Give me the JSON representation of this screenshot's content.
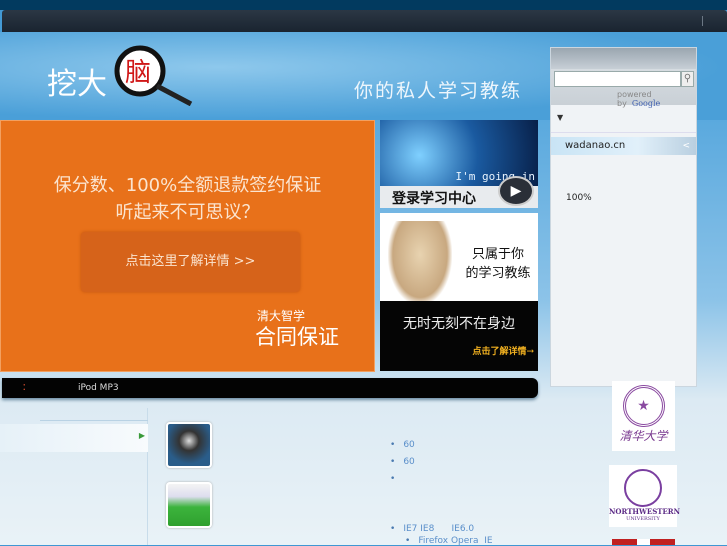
{
  "header": {
    "logo_text": "挖大脑",
    "slogan": "你的私人学习教练"
  },
  "search": {
    "placeholder": "",
    "powered_by": "powered by",
    "google": "Google"
  },
  "panel": {
    "dropdown_arrow": "▼",
    "site": "wadanao.cn",
    "zoom": "100%"
  },
  "promo": {
    "line1": "保分数、100%全额退款签约保证",
    "line2": "听起来不可思议？",
    "button": "点击这里了解详情 >>",
    "brand": "清大智学",
    "guarantee": "合同保证"
  },
  "ad_login": {
    "overlay": "I'm going in",
    "label": "登录学习中心"
  },
  "ad_coach": {
    "line1": "只属于你",
    "line2": "的学习教练",
    "tagline": "无时无刻不在身边",
    "link": "点击了解详情→"
  },
  "newsbar": {
    "colon": "：",
    "text": "iPod MP3"
  },
  "features": [
    "60",
    "60",
    "",
    "IE7 IE8      IE6.0",
    "Firefox Opera  IE"
  ],
  "partners": {
    "tsinghua": "清华大学",
    "northwestern": "NORTHWESTERN",
    "northwestern_sub": "UNIVERSITY"
  }
}
